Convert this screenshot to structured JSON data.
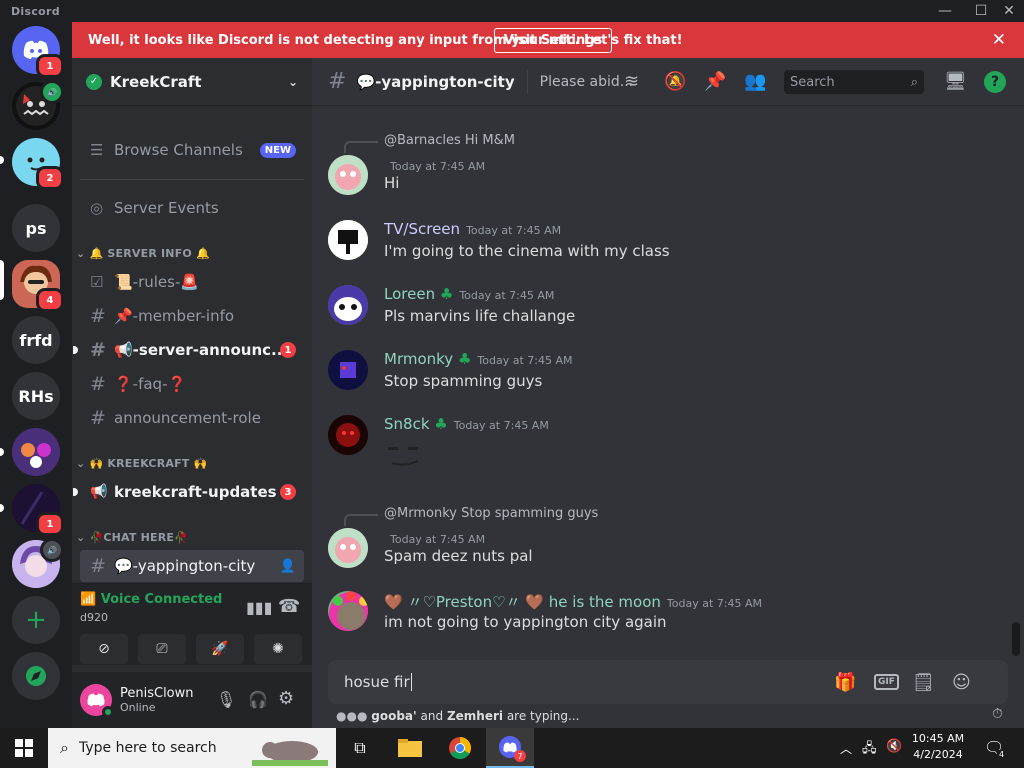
{
  "app": {
    "title": "Discord"
  },
  "banner": {
    "message": "Well, it looks like Discord is not detecting any input from your mic. Let's fix that!",
    "button": "Visit Settings"
  },
  "servers": [
    {
      "kind": "home",
      "badge": "1"
    },
    {
      "kind": "image",
      "badge": ""
    },
    {
      "kind": "image",
      "badge": "2"
    },
    {
      "kind": "text",
      "label": "ps",
      "badge": ""
    },
    {
      "kind": "image",
      "badge": "4"
    },
    {
      "kind": "text",
      "label": "frfd",
      "badge": ""
    },
    {
      "kind": "text",
      "label": "RHs",
      "badge": ""
    },
    {
      "kind": "image",
      "badge": ""
    },
    {
      "kind": "image",
      "badge": "1"
    },
    {
      "kind": "image",
      "badge": ""
    }
  ],
  "server": {
    "name": "KreekCraft"
  },
  "sidebar": {
    "browse_label": "Browse Channels",
    "browse_badge": "NEW",
    "events_label": "Server Events",
    "categories": [
      "🔔 SERVER INFO 🔔",
      "🙌 KREEKCRAFT 🙌",
      "🥀CHAT HERE🥀"
    ],
    "channels": [
      {
        "name": "📜-rules-🚨",
        "badge": ""
      },
      {
        "name": "📌-member-info",
        "badge": ""
      },
      {
        "name": "📢-server-announc...",
        "badge": "1"
      },
      {
        "name": "❓-faq-❓",
        "badge": ""
      },
      {
        "name": "announcement-role",
        "badge": ""
      },
      {
        "name": "kreekcraft-updates",
        "badge": "3"
      },
      {
        "name": "💬-yappington-city",
        "badge": ""
      }
    ]
  },
  "voice": {
    "status": "Voice Connected",
    "channel": "d920"
  },
  "user": {
    "name": "PenisClown",
    "status": "Online"
  },
  "channel_header": {
    "name": "💬-yappington-city",
    "topic": "Please abid...",
    "search_placeholder": "Search"
  },
  "messages": [
    {
      "reply_to": "@Barnacles",
      "reply_text": "Hi M&M",
      "author": "",
      "time": "Today at 7:45 AM",
      "text": "Hi",
      "name_color": "#dbdee1"
    },
    {
      "author": "TV/Screen",
      "time": "Today at 7:45 AM",
      "text": "I'm going to the cinema with my class",
      "name_color": "#c9cdfb"
    },
    {
      "author": "Loreen",
      "time": "Today at 7:45 AM",
      "text": "Pls marvins life challange",
      "name_color": "#8fd4c0"
    },
    {
      "author": "Mrmonky",
      "time": "Today at 7:45 AM",
      "text": "Stop spamming guys",
      "name_color": "#8fd4c0"
    },
    {
      "author": "Sn8ck",
      "time": "Today at 7:45 AM",
      "text": "",
      "name_color": "#8fd4c0"
    },
    {
      "reply_to": "@Mrmonky",
      "reply_text": "Stop spamming guys",
      "author": "",
      "time": "Today at 7:45 AM",
      "text": "Spam deez nuts pal",
      "name_color": "#dbdee1"
    },
    {
      "author": "🤎 〃♡Preston♡〃 🤎 he is the moon",
      "time": "Today at 7:45 AM",
      "text": "im not going to yappington city again",
      "name_color": "#8fd4c0"
    }
  ],
  "composer": {
    "value": "hosue fir",
    "gif": "GIF"
  },
  "typing": {
    "user1": "gooba'",
    "and": "and",
    "user2": "Zemheri",
    "suffix": "are typing..."
  },
  "taskbar": {
    "search_placeholder": "Type here to search",
    "time": "10:45 AM",
    "date": "4/2/2024",
    "notif_count": "4",
    "discord_badge": "7"
  }
}
